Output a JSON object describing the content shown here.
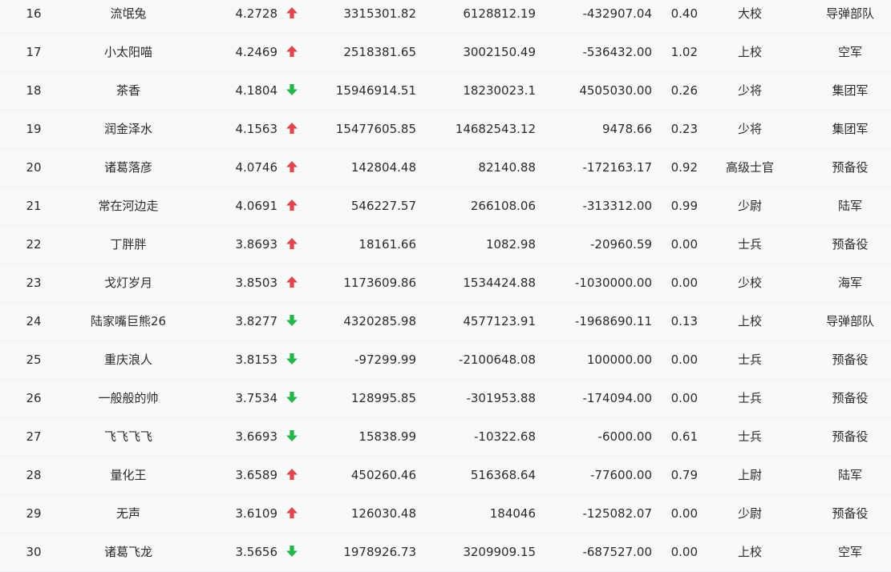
{
  "colors": {
    "up": "#e0484d",
    "down": "#27b34a",
    "text": "#2b2b2b",
    "background": "#f7f8fa",
    "divider": "#eceef2"
  },
  "rows": [
    {
      "rank": "16",
      "name": "流氓兔",
      "score": "4.2728",
      "trend": "up",
      "v1": "3315301.82",
      "v2": "6128812.19",
      "v3": "-432907.04",
      "ratio": "0.40",
      "rank_name": "大校",
      "unit": "导弹部队"
    },
    {
      "rank": "17",
      "name": "小太阳喵",
      "score": "4.2469",
      "trend": "up",
      "v1": "2518381.65",
      "v2": "3002150.49",
      "v3": "-536432.00",
      "ratio": "1.02",
      "rank_name": "上校",
      "unit": "空军"
    },
    {
      "rank": "18",
      "name": "茶香",
      "score": "4.1804",
      "trend": "down",
      "v1": "15946914.51",
      "v2": "18230023.1",
      "v3": "4505030.00",
      "ratio": "0.26",
      "rank_name": "少将",
      "unit": "集团军"
    },
    {
      "rank": "19",
      "name": "润金泽水",
      "score": "4.1563",
      "trend": "up",
      "v1": "15477605.85",
      "v2": "14682543.12",
      "v3": "9478.66",
      "ratio": "0.23",
      "rank_name": "少将",
      "unit": "集团军"
    },
    {
      "rank": "20",
      "name": "诸葛落彦",
      "score": "4.0746",
      "trend": "up",
      "v1": "142804.48",
      "v2": "82140.88",
      "v3": "-172163.17",
      "ratio": "0.92",
      "rank_name": "高级士官",
      "unit": "预备役"
    },
    {
      "rank": "21",
      "name": "常在河边走",
      "score": "4.0691",
      "trend": "up",
      "v1": "546227.57",
      "v2": "266108.06",
      "v3": "-313312.00",
      "ratio": "0.99",
      "rank_name": "少尉",
      "unit": "陆军"
    },
    {
      "rank": "22",
      "name": "丁胖胖",
      "score": "3.8693",
      "trend": "up",
      "v1": "18161.66",
      "v2": "1082.98",
      "v3": "-20960.59",
      "ratio": "0.00",
      "rank_name": "士兵",
      "unit": "预备役"
    },
    {
      "rank": "23",
      "name": "戈灯岁月",
      "score": "3.8503",
      "trend": "up",
      "v1": "1173609.86",
      "v2": "1534424.88",
      "v3": "-1030000.00",
      "ratio": "0.00",
      "rank_name": "少校",
      "unit": "海军"
    },
    {
      "rank": "24",
      "name": "陆家嘴巨熊26",
      "score": "3.8277",
      "trend": "down",
      "v1": "4320285.98",
      "v2": "4577123.91",
      "v3": "-1968690.11",
      "ratio": "0.13",
      "rank_name": "上校",
      "unit": "导弹部队"
    },
    {
      "rank": "25",
      "name": "重庆浪人",
      "score": "3.8153",
      "trend": "down",
      "v1": "-97299.99",
      "v2": "-2100648.08",
      "v3": "100000.00",
      "ratio": "0.00",
      "rank_name": "士兵",
      "unit": "预备役"
    },
    {
      "rank": "26",
      "name": "一般般的帅",
      "score": "3.7534",
      "trend": "down",
      "v1": "128995.85",
      "v2": "-301953.88",
      "v3": "-174094.00",
      "ratio": "0.00",
      "rank_name": "士兵",
      "unit": "预备役"
    },
    {
      "rank": "27",
      "name": "飞飞飞飞",
      "score": "3.6693",
      "trend": "down",
      "v1": "15838.99",
      "v2": "-10322.68",
      "v3": "-6000.00",
      "ratio": "0.61",
      "rank_name": "士兵",
      "unit": "预备役"
    },
    {
      "rank": "28",
      "name": "量化王",
      "score": "3.6589",
      "trend": "up",
      "v1": "450260.46",
      "v2": "516368.64",
      "v3": "-77600.00",
      "ratio": "0.79",
      "rank_name": "上尉",
      "unit": "陆军"
    },
    {
      "rank": "29",
      "name": "无声",
      "score": "3.6109",
      "trend": "up",
      "v1": "126030.48",
      "v2": "184046",
      "v3": "-125082.07",
      "ratio": "0.00",
      "rank_name": "少尉",
      "unit": "预备役"
    },
    {
      "rank": "30",
      "name": "诸葛飞龙",
      "score": "3.5656",
      "trend": "down",
      "v1": "1978926.73",
      "v2": "3209909.15",
      "v3": "-687527.00",
      "ratio": "0.00",
      "rank_name": "上校",
      "unit": "空军"
    }
  ]
}
